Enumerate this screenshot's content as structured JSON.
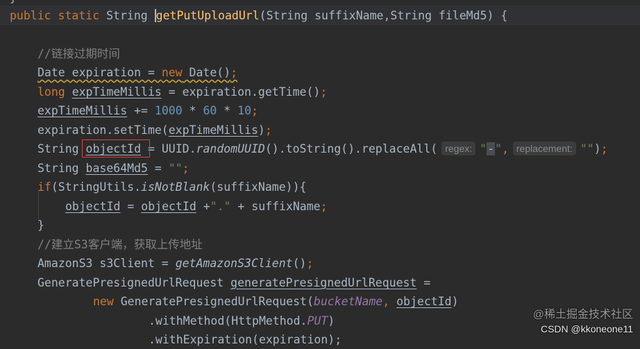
{
  "editor": {
    "top_fragment": "}",
    "signature": {
      "kw1": "public",
      "kw2": "static",
      "type": "String",
      "method": "getPutUploadUrl",
      "params": "(String suffixName,String fileMd5) {"
    },
    "comment1": "//链接过期时间",
    "l_date": {
      "pre": "Date expiration = ",
      "kw": "new",
      "rest": " Date()",
      "semi": ";"
    },
    "l_long": {
      "kw": "long",
      "var": "expTimeMillis",
      "rest": " = expiration.getTime()",
      "semi": ";"
    },
    "l_add": {
      "var": "expTimeMillis",
      "op": " += ",
      "n1": "1000",
      "m1": " * ",
      "n2": "60",
      "m2": " * ",
      "n3": "10",
      "semi": ";"
    },
    "l_set": {
      "pre": "expiration.setTime(",
      "var": "expTimeMillis",
      "close": ")",
      "semi": ";"
    },
    "l_obj": {
      "type": "String ",
      "var": "objectId",
      "eq": " = UUID.",
      "method": "randomUUID",
      "rest": "().toString().replaceAll(",
      "hint1": "regex:",
      "s1q1": "\"",
      "dash": "-",
      "s1q2": "\"",
      "comma": ",",
      "hint2": "replacement:",
      "s2": "\"\"",
      "close": ")",
      "semi": ";"
    },
    "l_b64": {
      "type": "String ",
      "var": "base64Md5",
      "eq": " = ",
      "str": "\"\"",
      "semi": ";"
    },
    "l_if": {
      "kw": "if",
      "pre": "(StringUtils.",
      "method": "isNotBlank",
      "rest": "(suffixName)){"
    },
    "l_assign": {
      "v1": "objectId",
      "eq": " = ",
      "v2": "objectId",
      "plus": " +",
      "dot": "\".\"",
      "rest": " + suffixName",
      "semi": ";"
    },
    "l_brace": "}",
    "comment2": "//建立S3客户端，获取上传地址",
    "l_s3": {
      "pre": "AmazonS3 s3Client = ",
      "method": "getAmazonS3Client",
      "rest": "()",
      "semi": ";"
    },
    "l_gen": {
      "pre": "GeneratePresignedUrlRequest ",
      "var": "generatePresignedUrlRequest",
      "eq": " ="
    },
    "l_new": {
      "kw": "new",
      "pre": " GeneratePresignedUrlRequest(",
      "p1": "bucketName",
      "comma": ", ",
      "p2": "objectId",
      "close": ")"
    },
    "l_with": {
      "pre": ".withMethod(HttpMethod.",
      "field": "PUT",
      "close": ")"
    },
    "l_exp": ".withExpiration(expiration);"
  },
  "watermark": {
    "line1": "@稀土掘金技术社区",
    "line2": "CSDN @kkoneone11"
  }
}
